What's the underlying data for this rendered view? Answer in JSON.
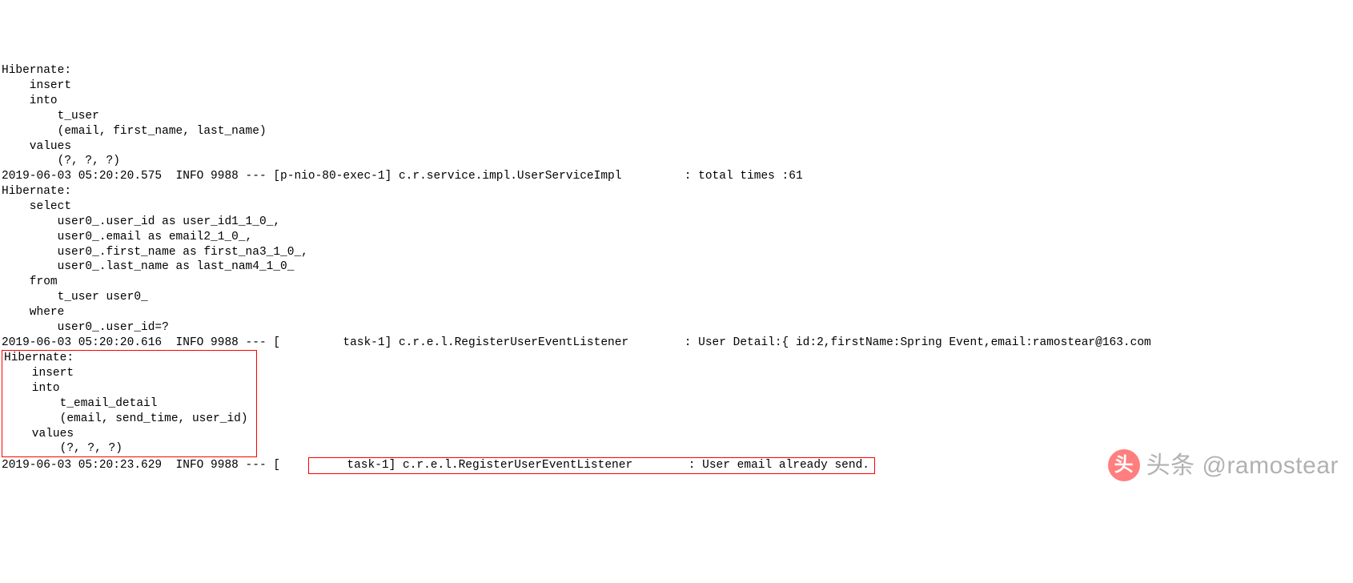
{
  "log": {
    "block1": "Hibernate: \n    insert \n    into\n        t_user\n        (email, first_name, last_name) \n    values\n        (?, ?, ?)",
    "line_info1": "2019-06-03 05:20:20.575  INFO 9988 --- [p-nio-80-exec-1] c.r.service.impl.UserServiceImpl         : total times :61",
    "block2": "Hibernate: \n    select\n        user0_.user_id as user_id1_1_0_,\n        user0_.email as email2_1_0_,\n        user0_.first_name as first_na3_1_0_,\n        user0_.last_name as last_nam4_1_0_ \n    from\n        t_user user0_ \n    where\n        user0_.user_id=?",
    "line_info2": "2019-06-03 05:20:20.616  INFO 9988 --- [         task-1] c.r.e.l.RegisterUserEventListener        : User Detail:{ id:2,firstName:Spring Event,email:ramostear@163.com",
    "boxed_block": "Hibernate: \n    insert \n    into\n        t_email_detail\n        (email, send_time, user_id) \n    values\n        (?, ?, ?)",
    "line_info3_prefix": "2019-06-03 05:20:23.629  INFO 9988 --- [",
    "line_info3_boxed": "     task-1] c.r.e.l.RegisterUserEventListener        : User email already send."
  },
  "watermark": {
    "logo_text": "头",
    "brand": "头条 @ramostear"
  }
}
